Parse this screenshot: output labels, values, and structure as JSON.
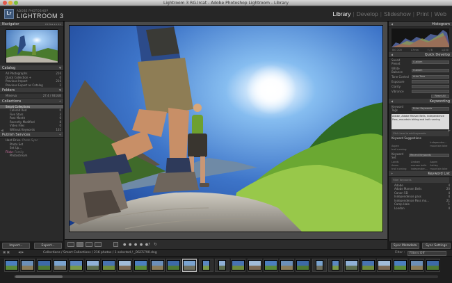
{
  "window": {
    "title": "Lightroom 3 RG.lrcat - Adobe Photoshop Lightroom - Library"
  },
  "identity": {
    "badge": "Lr",
    "adobe": "ADOBE PHOTOSHOP",
    "product": "LIGHTROOM 3"
  },
  "modules": [
    {
      "label": "Library",
      "active": true
    },
    {
      "label": "Develop",
      "active": false
    },
    {
      "label": "Slideshow",
      "active": false
    },
    {
      "label": "Print",
      "active": false
    },
    {
      "label": "Web",
      "active": false
    }
  ],
  "left": {
    "navigator": {
      "title": "Navigator",
      "zoom": "FIT  FILL  1:1  3:1"
    },
    "catalog": {
      "title": "Catalog",
      "items": [
        {
          "label": "All Photographs",
          "count": "216"
        },
        {
          "label": "Quick Collection +",
          "count": "0"
        },
        {
          "label": "Previous Import",
          "count": "216"
        },
        {
          "label": "Previous Export as Catalog",
          "count": "2"
        }
      ]
    },
    "folders": {
      "title": "Folders",
      "items": [
        {
          "label": "Minerva",
          "count": "27.4 / 931GB"
        }
      ]
    },
    "collections": {
      "title": "Collections",
      "items": [
        {
          "label": "Smart Collections",
          "count": "",
          "selected": true
        },
        {
          "label": "Colored Red",
          "count": "0"
        },
        {
          "label": "Five Stars",
          "count": "3"
        },
        {
          "label": "Past Month",
          "count": "0"
        },
        {
          "label": "Recently Modified",
          "count": "8"
        },
        {
          "label": "Video Files",
          "count": "0"
        },
        {
          "label": "Without Keywords",
          "count": "102"
        }
      ]
    },
    "publish": {
      "title": "Publish Services",
      "items": [
        {
          "label": "Hard Drive",
          "sub": ": Photo Sync"
        },
        {
          "label": "Photo Set",
          "sub": ""
        },
        {
          "label": "Set Up...",
          "sub": ""
        },
        {
          "label": "Flickr",
          "sub": ": Family"
        },
        {
          "label": "Photostream",
          "sub": ""
        }
      ]
    },
    "buttons": {
      "import": "Import...",
      "export": "Export..."
    }
  },
  "right": {
    "histogram": {
      "title": "Histogram",
      "info": [
        "ISO 200",
        "17mm",
        "f / 8",
        "1/250"
      ]
    },
    "quickdevelop": {
      "title": "Quick Develop",
      "rows": [
        {
          "label": "Saved Preset",
          "value": "Custom"
        },
        {
          "label": "White Balance",
          "value": "Custom"
        },
        {
          "label": "Tone Control",
          "value": "Auto Tone"
        },
        {
          "label": "Exposure",
          "value": ""
        },
        {
          "label": "Clarity",
          "value": ""
        },
        {
          "label": "Vibrance",
          "value": ""
        }
      ],
      "reset": "Reset All"
    },
    "keywording": {
      "title": "Keywording",
      "tags_label": "Keyword Tags",
      "tags_value": "Enter Keywords",
      "keywords": "Adobe, Adobe Marsen Bells, Independence Pass, mountain biking and trail running",
      "hint": "Click here to add keywords",
      "suggestions_title": "Keyword Suggestions",
      "suggestions": [
        "",
        "",
        "Independen...",
        "Aspen",
        "",
        "mountain bike",
        "trail running",
        "",
        ""
      ],
      "set_label": "Keyword Set",
      "set_value": "Recent Keywords",
      "set_items": [
        "Lands",
        "Lindsey",
        "Aspen",
        "Ames",
        "maroon bells",
        "Ashley",
        "trail running",
        "Independen...",
        "mountain bike"
      ]
    },
    "keywordlist": {
      "title": "Keyword List",
      "filter": "Filter Keywords",
      "items": [
        {
          "label": "Adobe",
          "count": "4"
        },
        {
          "label": "Adobe Marsen Bells",
          "count": "20"
        },
        {
          "label": "Canon 5D",
          "count": "4"
        },
        {
          "label": "Independence pass",
          "count": "4"
        },
        {
          "label": "Independence Pass mo...",
          "count": "21"
        },
        {
          "label": "Camp Hale",
          "count": "1"
        },
        {
          "label": "London",
          "count": "4"
        }
      ]
    },
    "buttons": {
      "sync_meta": "Sync Metadata",
      "sync_settings": "Sync Settings"
    }
  },
  "filmstrip": {
    "path": "Collections / Smart Collections / 216 photos / 1 selected / _DSC5790.dng",
    "filter_label": "Filter :",
    "filter_value": "Filters Off"
  }
}
